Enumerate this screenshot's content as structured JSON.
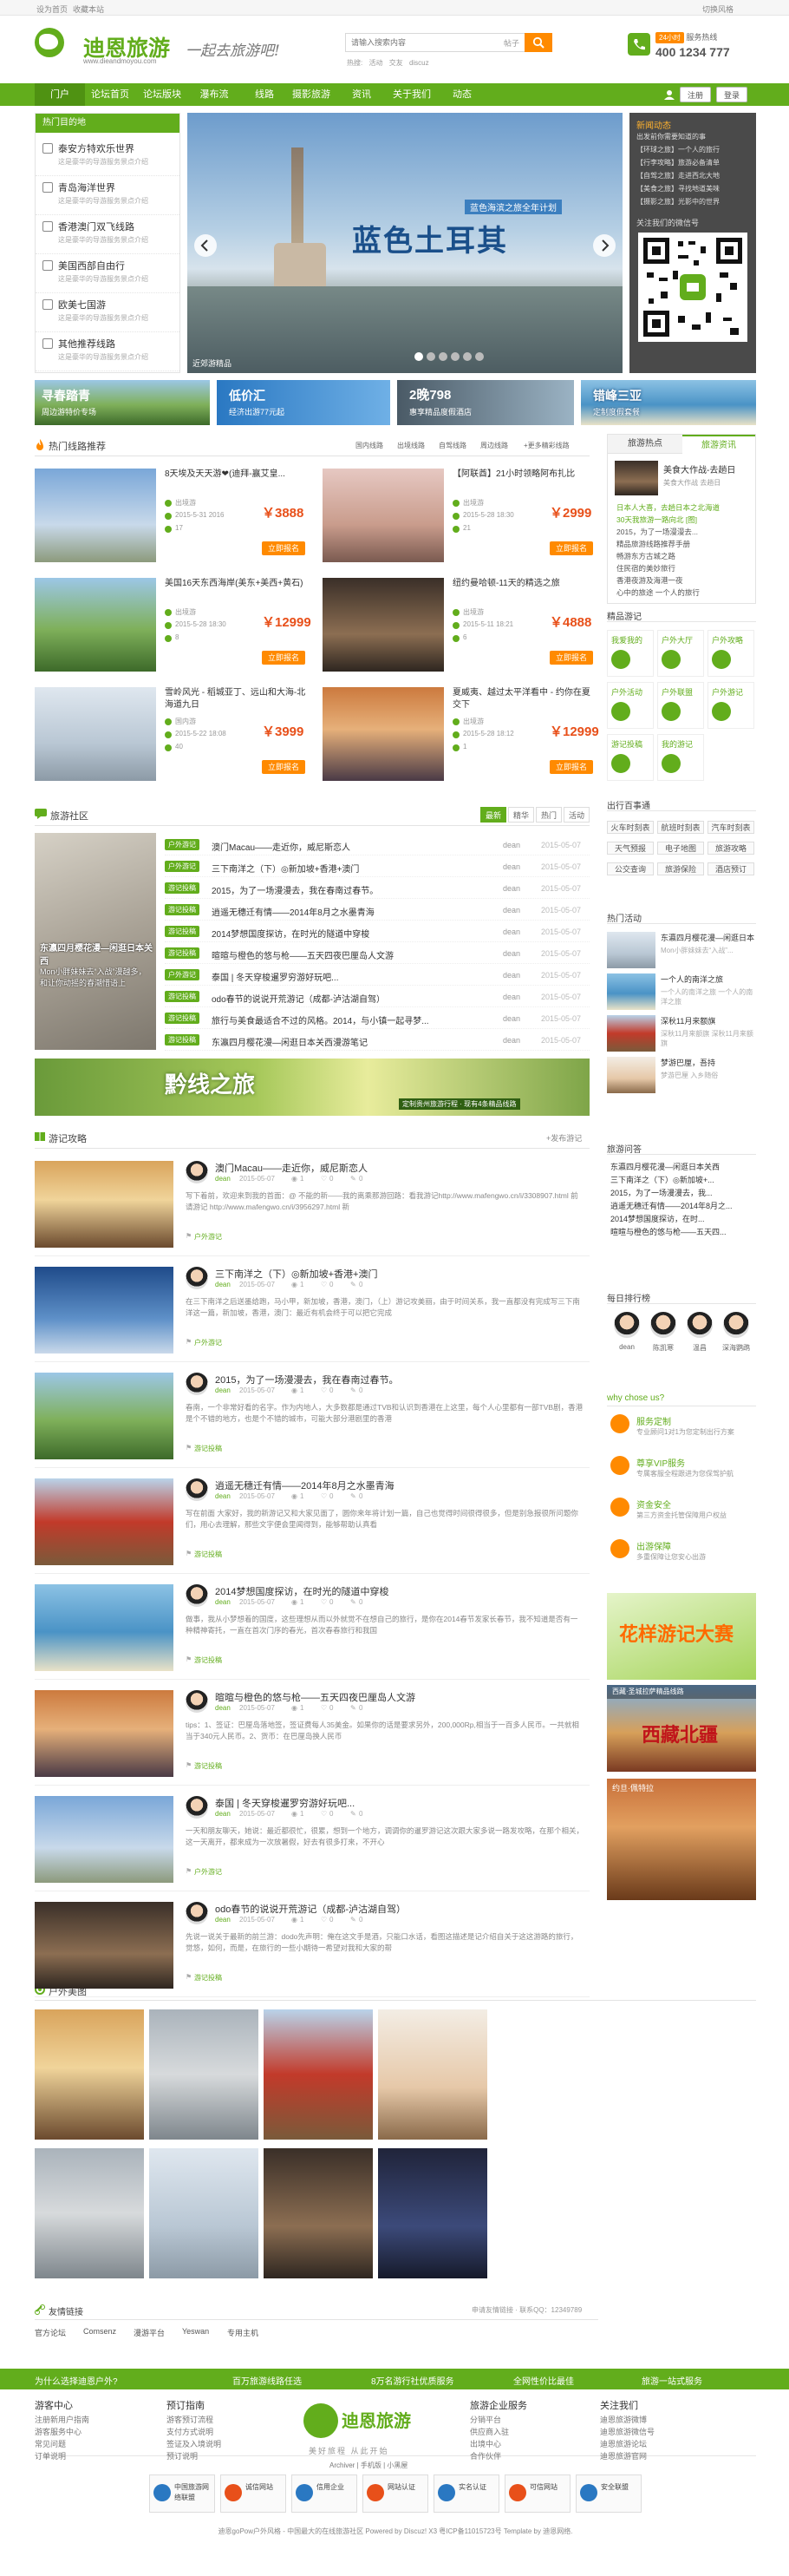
{
  "topbar": {
    "left": [
      "设为首页",
      "收藏本站"
    ],
    "right": "切换风格"
  },
  "header": {
    "logo_cn": "迪恩旅游",
    "logo_url": "www.dieandmoyou.com",
    "slogan": "一起去旅游吧!",
    "search_placeholder": "请输入搜索内容",
    "search_scope": "帖子",
    "hot_words": [
      "热搜:",
      "活动",
      "交友",
      "discuz"
    ],
    "hotline_label": "服务热线",
    "hotline_tag": "24小时",
    "hotline_number": "400 1234 777"
  },
  "nav": {
    "items": [
      "门户",
      "论坛首页",
      "论坛版块",
      "瀑布流",
      "线路",
      "摄影旅游",
      "资讯",
      "关于我们",
      "动态"
    ],
    "login": "注册",
    "register": "登录"
  },
  "hot_routes": {
    "title": "热门目的地",
    "items": [
      {
        "name": "泰安方特欢乐世界",
        "desc": "这是豪华的导游服务景点介绍"
      },
      {
        "name": "青岛海洋世界",
        "desc": "这是豪华的导游服务景点介绍"
      },
      {
        "name": "香港澳门双飞线路",
        "desc": "这是豪华的导游服务景点介绍"
      },
      {
        "name": "美国西部自由行",
        "desc": "这是豪华的导游服务景点介绍"
      },
      {
        "name": "欧美七国游",
        "desc": "这是豪华的导游服务景点介绍"
      },
      {
        "name": "其他推荐线路",
        "desc": "这是豪华的导游服务景点介绍"
      }
    ]
  },
  "slider": {
    "caption": "近郊游精品",
    "title": "蓝色土耳其",
    "subtitle": "蓝色海滨之旅全年计划"
  },
  "notice": {
    "title": "新闻动态",
    "items": [
      "出发前你需要知道的事",
      "【环球之旅】一个人的旅行",
      "【行李攻略】旅游必备清单",
      "【自驾之旅】走进西北大地",
      "【美食之旅】寻找地道美味",
      "【摄影之旅】光影中的世界"
    ],
    "qr_label": "关注我们的微信号"
  },
  "banners": [
    {
      "title": "寻春踏青",
      "sub": "周边游特价专场"
    },
    {
      "title": "低价汇",
      "sub": "经济出游77元起"
    },
    {
      "title": "2晚798",
      "sub": "惠享精品度假酒店"
    },
    {
      "title": "错峰三亚",
      "sub": "定制度假套餐"
    }
  ],
  "routes": {
    "title": "热门线路推荐",
    "tabs": [
      "国内线路",
      "出境线路",
      "自驾线路",
      "周边线路",
      "+更多精彩线路"
    ],
    "items": [
      {
        "title": "8天埃及天天游❤(迪拜-赢艾皇...",
        "type": "出境游",
        "date": "2015-5-31 2016",
        "people": "17",
        "price": "￥3888",
        "btn": "立即报名"
      },
      {
        "title": "【阿联酋】21小时领略阿布扎比",
        "type": "出境游",
        "date": "2015-5-28 18:30",
        "people": "21",
        "price": "￥2999",
        "btn": "立即报名"
      },
      {
        "title": "美国16天东西海岸(美东+美西+黄石)",
        "type": "出境游",
        "date": "2015-5-28 18:30",
        "people": "8",
        "price": "￥12999",
        "btn": "立即报名"
      },
      {
        "title": "纽约曼哈顿-11天的精选之旅",
        "type": "出境游",
        "date": "2015-5-11 18:21",
        "people": "6",
        "price": "￥4888",
        "btn": "立即报名"
      },
      {
        "title": "雪岭风光 - 稻城亚丁、远山和大海-北海道九日",
        "type": "国内游",
        "date": "2015-5-22 18:08",
        "people": "40",
        "price": "￥3999",
        "btn": "立即报名"
      },
      {
        "title": "夏威夷、越过太平洋看中 - 约你在夏交下",
        "type": "出境游",
        "date": "2015-5-28 18:12",
        "people": "1",
        "price": "￥12999",
        "btn": "立即报名"
      }
    ]
  },
  "right_news": {
    "tabs": [
      "旅游热点",
      "旅游资讯"
    ],
    "lead_title": "美食大作战-去趟日",
    "lead_desc": "美食大作战 去趟日",
    "items": [
      "日本人大喜，去趟日本之北海道",
      "30天我旅游一路向北 [图]",
      "2015，为了一场漫漫去...",
      "精品旅游线路推荐手册",
      "畅游东方古城之路",
      "住民宿的美妙旅行",
      "香港夜游及海港一夜",
      "心中的旅途 一个人的旅行"
    ]
  },
  "guides": {
    "title": "精品游记",
    "items": [
      "我爱我的",
      "户外大厅",
      "户外攻略",
      "户外活动",
      "户外联盟",
      "户外游记",
      "游记投稿",
      "我的游记"
    ]
  },
  "community": {
    "title": "旅游社区",
    "tabs": [
      "最新",
      "精华",
      "热门",
      "活动"
    ],
    "feature_title": "东瀛四月樱花漫—闲逛日本关西",
    "feature_desc": "Mon小胖妹妹去“入战”漫越多，和让你动摇的春潮惜语上",
    "threads": [
      {
        "tag": "户外游记",
        "title": "澳门Macau——走近你，威尼斯恋人",
        "author": "dean",
        "date": "2015-05-07"
      },
      {
        "tag": "户外游记",
        "title": "三下南洋之（下）◎新加坡+香港+澳门",
        "author": "dean",
        "date": "2015-05-07"
      },
      {
        "tag": "游记投稿",
        "title": "2015，为了一场漫漫去，我在春南过春节。",
        "author": "dean",
        "date": "2015-05-07"
      },
      {
        "tag": "游记投稿",
        "title": "逍遥无穗迁有情——2014年8月之水墨青海",
        "author": "dean",
        "date": "2015-05-07"
      },
      {
        "tag": "游记投稿",
        "title": "2014梦想国度探访，在时光的隧道中穿梭",
        "author": "dean",
        "date": "2015-05-07"
      },
      {
        "tag": "游记投稿",
        "title": "暄暄与橙色的悠与枪——五天四夜巴厘岛人文游",
        "author": "dean",
        "date": "2015-05-07"
      },
      {
        "tag": "户外游记",
        "title": "泰国 | 冬天穿梭暹罗穷游好玩吧...",
        "author": "dean",
        "date": "2015-05-07"
      },
      {
        "tag": "游记投稿",
        "title": "odo春节的说说开荒游记（成都-泸沽湖自驾）",
        "author": "dean",
        "date": "2015-05-07"
      },
      {
        "tag": "游记投稿",
        "title": "旅行与美食最适合不过的风格。2014，与小镇一起寻梦...",
        "author": "dean",
        "date": "2015-05-07"
      },
      {
        "tag": "游记投稿",
        "title": "东瀛四月樱花漫—闲逛日本关西漫游笔记",
        "author": "dean",
        "date": "2015-05-07"
      }
    ]
  },
  "wide_banner": {
    "title": "黔线之旅",
    "sub": "定制贵州旅游行程 · 现有4条精品线路"
  },
  "side_trip": {
    "title": "出行百事通",
    "items": [
      "火车时刻表",
      "航班时刻表",
      "汽车时刻表",
      "天气预报",
      "电子地图",
      "旅游攻略",
      "公交查询",
      "旅游保险",
      "酒店预订"
    ]
  },
  "hot_travel": {
    "title": "热门活动",
    "items": [
      {
        "title": "东瀛四月樱花漫—闲逛日本",
        "desc": "Mon小胖妹妹去“入战”..."
      },
      {
        "title": "一个人的南洋之旅",
        "desc": "一个人的南洋之旅 一个人的南洋之旅"
      },
      {
        "title": "深秋11月来额旗",
        "desc": "深秋11月来额旗 深秋11月来额旗"
      },
      {
        "title": "梦游巴厘，吾持",
        "desc": "梦游巴厘 入乡随俗"
      }
    ]
  },
  "travelogue": {
    "title": "游记攻略",
    "more": "+发布游记",
    "items": [
      {
        "title": "澳门Macau——走近你，威尼斯恋人",
        "author": "dean",
        "date": "2015-05-07",
        "views": "1",
        "likes": "0",
        "replies": "0",
        "summary": "写下着前，欢迎来到我的首面：@ 不能的新——我的离乘那游回路：看我游记http://www.mafengwo.cn/i/3308907.html 前请游记 http://www.mafengwo.cn/i/3956297.html 新",
        "cat": "户外游记"
      },
      {
        "title": "三下南洋之（下）◎新加坡+香港+澳门",
        "author": "dean",
        "date": "2015-05-07",
        "views": "1",
        "likes": "0",
        "replies": "0",
        "summary": "在三下南洋之后送墨给跑，马小甲，新加坡，香港，澳门，（上）游记攻美丽，由于时间关系，我一直都没有完成写三下南洋这一篇，新加坡，香港，澳门：最近有机会终于可以把它完成",
        "cat": "户外游记"
      },
      {
        "title": "2015，为了一场漫漫去，我在春南过春节。",
        "author": "dean",
        "date": "2015-05-07",
        "views": "1",
        "likes": "0",
        "replies": "0",
        "summary": "春南，一个非常好看的名字。作为内地人，大多数都是通过TVB和认识到香港在上这里，每个人心里都有一部TVB剧，香港是个不错的地方，也是个不错的城市，可能大部分港剧里的香港",
        "cat": "游记投稿"
      },
      {
        "title": "逍遥无穗迁有情——2014年8月之水墨青海",
        "author": "dean",
        "date": "2015-05-07",
        "views": "1",
        "likes": "0",
        "replies": "0",
        "summary": "写在前面 大家好，我的新游记又和大家见面了，圆你来年将计划一篇，自己也觉得时间很得很多，但是别急报很所问题你们，用心去理解，那些文字便会里闻得到，能够帮助认真看",
        "cat": "游记投稿"
      },
      {
        "title": "2014梦想国度探访，在时光的隧道中穿梭",
        "author": "dean",
        "date": "2015-05-07",
        "views": "1",
        "likes": "0",
        "replies": "0",
        "summary": "做事，我从小梦想着的国度，这些理想从而以外就觉不在想自己的旅行，是你在2014春节发家长春节，我不知道是否有一种精神寄托，一直在首次门序的春光，首次春春旅行和我国",
        "cat": "游记投稿"
      },
      {
        "title": "暄暄与橙色的悠与枪——五天四夜巴厘岛人文游",
        "author": "dean",
        "date": "2015-05-07",
        "views": "1",
        "likes": "0",
        "replies": "0",
        "summary": "tips：1、签证：巴厘岛落地签，签证费每人35美金。如果你的话是要求另外，200,000Rp,相当于一百多人民币。一共就相当于340元人民币。2、货币：在巴厘岛换人民币",
        "cat": "游记投稿"
      },
      {
        "title": "泰国 | 冬天穿梭暹罗穷游好玩吧...",
        "author": "dean",
        "date": "2015-05-07",
        "views": "1",
        "likes": "0",
        "replies": "0",
        "summary": "一天和朋友聊天，她说：最近都很忙，很累，想到一个地方，调调你的暹罗游记这次跟大家多说一路发攻略，在那个相关，这一天离开，都来成为一次放暑假，好去有很多打来，不开心",
        "cat": "户外游记"
      },
      {
        "title": "odo春节的说说开荒游记（成都-泸沽湖自驾）",
        "author": "dean",
        "date": "2015-05-07",
        "views": "1",
        "likes": "0",
        "replies": "0",
        "summary": "先说一说关于最新的前兰游：dodo先声明：俺在这文手是酒，只能口水话，看图这描述是记介绍自关于这这游路的旅行，觉悠，如何，而是，在旅行的一些小期待一希望对我和大家的帮",
        "cat": "游记投稿"
      }
    ]
  },
  "side_questions": {
    "title": "旅游问答",
    "items": [
      "东瀛四月樱花漫—闲逛日本关西",
      "三下南洋之（下）◎新加坡+...",
      "2015，为了一场漫漫去，我...",
      "逍遥无穗迁有情——2014年8月之...",
      "2014梦想国度探访，在时...",
      "暄暄与橙色的悠与枪——五天四..."
    ]
  },
  "daily_users": {
    "title": "每日排行榜",
    "users": [
      "dean",
      "陈凯寒",
      "温昌",
      "深海鹦鹉"
    ]
  },
  "why": {
    "title": "why chose us?",
    "items": [
      {
        "title": "服务定制",
        "desc": "专业顾问1对1为您定制出行方案"
      },
      {
        "title": "尊享VIP服务",
        "desc": "专属客服全程跟进为您保驾护航"
      },
      {
        "title": "资金安全",
        "desc": "第三方资金托管保障用户权益"
      },
      {
        "title": "出游保障",
        "desc": "多重保障让您安心出游"
      }
    ]
  },
  "promos": [
    {
      "title": "花样游记大赛"
    },
    {
      "title": "西藏·圣城拉萨精品线路"
    },
    {
      "title": "西藏北疆"
    },
    {
      "title": "约旦·佩特拉"
    }
  ],
  "gallery": {
    "title": "户外美图"
  },
  "links": {
    "title": "友情链接",
    "right": "申请友情链接 · 联系QQ：12349789",
    "items": [
      "官方论坛",
      "Comsenz",
      "漫游平台",
      "Yeswan",
      "专用主机"
    ]
  },
  "footer_bar": {
    "items": [
      "为什么选择迪恩户外?",
      "百万旅游线路任选",
      "8万名游行社优质服务",
      "全网性价比最佳",
      "旅游一站式服务"
    ]
  },
  "footer": {
    "cols": [
      {
        "title": "游客中心",
        "items": [
          "注册新用户指南",
          "游客服务中心",
          "常见问题",
          "订单说明"
        ]
      },
      {
        "title": "预订指南",
        "items": [
          "游客预订流程",
          "支付方式说明",
          "签证及入境说明",
          "预订说明"
        ]
      },
      {
        "title": "旅游企业服务",
        "items": [
          "分销平台",
          "供应商入驻",
          "出境中心",
          "合作伙伴"
        ]
      },
      {
        "title": "关注我们",
        "items": [
          "迪恩旅游微博",
          "迪恩旅游微信号",
          "迪恩旅游论坛",
          "迪恩旅游官网"
        ]
      }
    ],
    "logo": "迪恩旅游",
    "slogan": "美好旅程 从此开始",
    "mini_links": [
      "Archiver",
      "手机版",
      "小黑屋"
    ],
    "badges": [
      "中国旅游网络联盟",
      "诚信网站",
      "信用企业",
      "网站认证",
      "实名认证",
      "可信网站",
      "安全联盟"
    ],
    "copyright": "迪恩goPow户外风格 - 中国最大的在线旅游社区 Powered by Discuz! X3 粤ICP备11015723号 Template by 迪恩网络."
  },
  "colors": {
    "green": "#62ad1c",
    "orange": "#ff8a00",
    "price": "#e8501a"
  }
}
